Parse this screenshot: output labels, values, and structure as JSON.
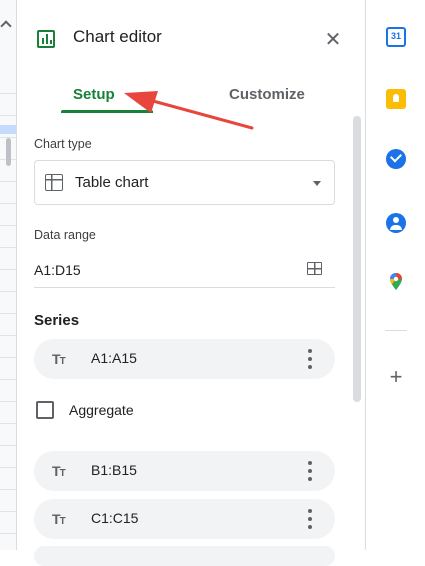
{
  "editor": {
    "title": "Chart editor",
    "close_icon": "close-icon",
    "tabs": [
      {
        "label": "Setup",
        "active": true
      },
      {
        "label": "Customize",
        "active": false
      }
    ],
    "chart_type": {
      "label": "Chart type",
      "value": "Table chart"
    },
    "data_range": {
      "label": "Data range",
      "value": "A1:D15"
    },
    "series": {
      "title": "Series",
      "items": [
        {
          "type_glyph": "Tт",
          "range": "A1:A15"
        },
        {
          "type_glyph": "Tт",
          "range": "B1:B15"
        },
        {
          "type_glyph": "Tт",
          "range": "C1:C15"
        }
      ],
      "aggregate_label": "Aggregate",
      "aggregate_checked": false
    }
  },
  "side_panel": {
    "apps": [
      {
        "name": "calendar",
        "icon": "calendar-icon",
        "text": "31"
      },
      {
        "name": "keep",
        "icon": "keep-icon"
      },
      {
        "name": "tasks",
        "icon": "tasks-icon"
      },
      {
        "name": "contacts",
        "icon": "contacts-icon"
      },
      {
        "name": "maps",
        "icon": "maps-icon"
      }
    ],
    "add_icon": "plus-icon"
  },
  "colors": {
    "accent_green": "#188038",
    "annotation_red": "#e8453c",
    "google_blue": "#1a73e8",
    "chip_bg": "#f1f3f4"
  }
}
